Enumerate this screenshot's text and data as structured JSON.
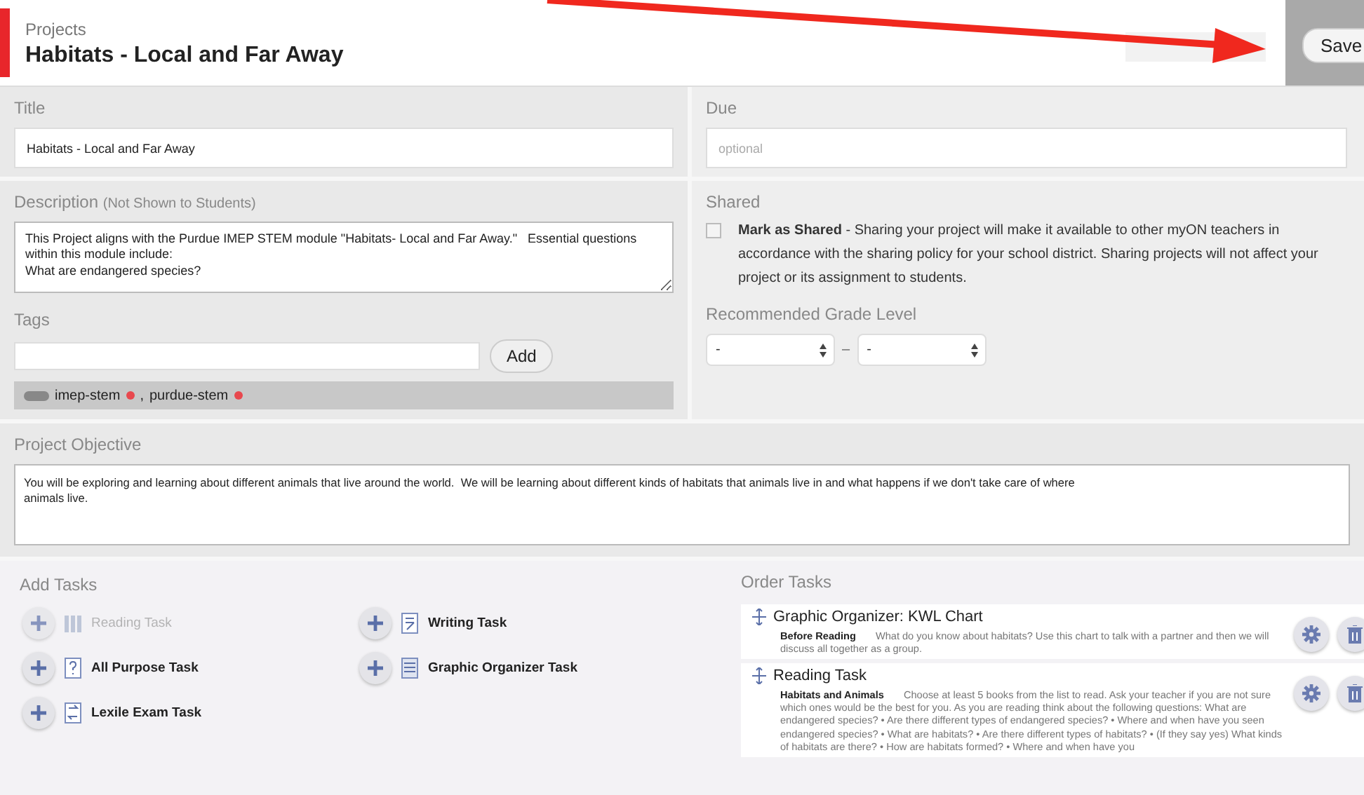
{
  "header": {
    "breadcrumb": "Projects",
    "title": "Habitats - Local and Far Away",
    "save_button": "Save"
  },
  "title_field": {
    "label": "Title",
    "value": "Habitats - Local and Far Away"
  },
  "due_field": {
    "label": "Due",
    "placeholder": "optional"
  },
  "description": {
    "label": "Description",
    "note": "(Not Shown to Students)",
    "value": "This Project aligns with the Purdue IMEP STEM module \"Habitats- Local and Far Away.\"   Essential questions within this module include:\nWhat are endangered species?"
  },
  "tags": {
    "label": "Tags",
    "add_button": "Add",
    "items": [
      "imep-stem",
      "purdue-stem"
    ],
    "separator": ","
  },
  "shared": {
    "label": "Shared",
    "checked": false,
    "checkbox_label": "Mark as Shared",
    "text": " - Sharing your project will make it available to other myON teachers in accordance with the sharing policy for your school district. Sharing projects will not affect your project or its assignment to students."
  },
  "grade_level": {
    "label": "Recommended Grade Level",
    "from": "-",
    "to": "-",
    "dash": "–"
  },
  "objective": {
    "label": "Project Objective",
    "value": "You will be exploring and learning about different animals that live around the world.  We will be learning about different kinds of habitats that animals live in and what happens if we don't take care of where\nanimals live."
  },
  "add_tasks": {
    "label": "Add Tasks",
    "items": [
      {
        "kind": "reading",
        "name": "Reading Task",
        "disabled": true
      },
      {
        "kind": "writing",
        "name": "Writing Task",
        "disabled": false
      },
      {
        "kind": "all_purpose",
        "name": "All Purpose Task",
        "disabled": false
      },
      {
        "kind": "graphic_organizer",
        "name": "Graphic Organizer Task",
        "disabled": false
      },
      {
        "kind": "lexile",
        "name": "Lexile Exam Task",
        "disabled": false
      }
    ]
  },
  "order_tasks": {
    "label": "Order Tasks",
    "items": [
      {
        "title": "Graphic Organizer: KWL Chart",
        "subtitle": "Before Reading",
        "text": "What do you know about habitats? Use this chart to talk with a partner and then we will discuss all together as a group."
      },
      {
        "title": "Reading Task",
        "subtitle": "Habitats and Animals",
        "text": "Choose at least 5 books from the list to read. Ask your teacher if you are not sure which ones would be the best for you. As you are reading think about the following questions: What are endangered species? • Are there different types of endangered species? • Where and when have you seen endangered species? • What are habitats? • Are there different types of habitats? • (If they say yes) What kinds of habitats are there? • How are habitats formed? • Where and when have you"
      }
    ]
  }
}
